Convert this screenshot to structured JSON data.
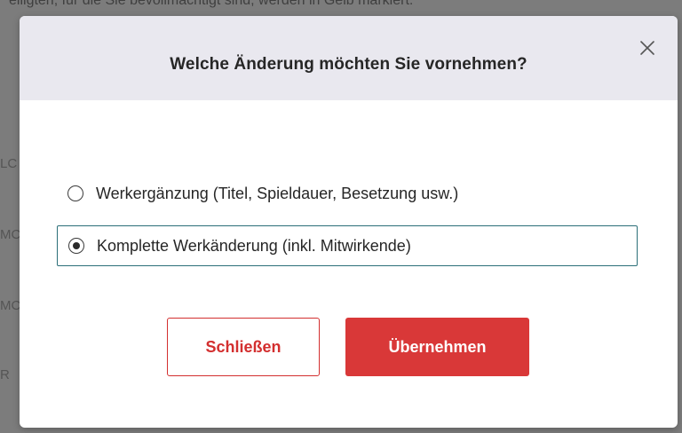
{
  "background": {
    "top_text": "eiligten, für die Sie bevollmächtigt sind, werden in Gelb markiert.",
    "side_fragments": [
      "LC",
      "MC",
      "MC",
      "R"
    ]
  },
  "dialog": {
    "title": "Welche Änderung möchten Sie vornehmen?",
    "close_icon": "close-icon",
    "options": [
      {
        "label": "Werkergänzung (Titel, Spieldauer, Besetzung usw.)",
        "selected": false
      },
      {
        "label": "Komplette Werkänderung (inkl. Mitwirkende)",
        "selected": true
      }
    ],
    "buttons": {
      "close_label": "Schließen",
      "apply_label": "Übernehmen"
    }
  },
  "colors": {
    "header_bg": "#e9e8ef",
    "accent_red": "#d93838",
    "selected_border": "#2b6f78",
    "overlay": "#7c7c7c"
  }
}
